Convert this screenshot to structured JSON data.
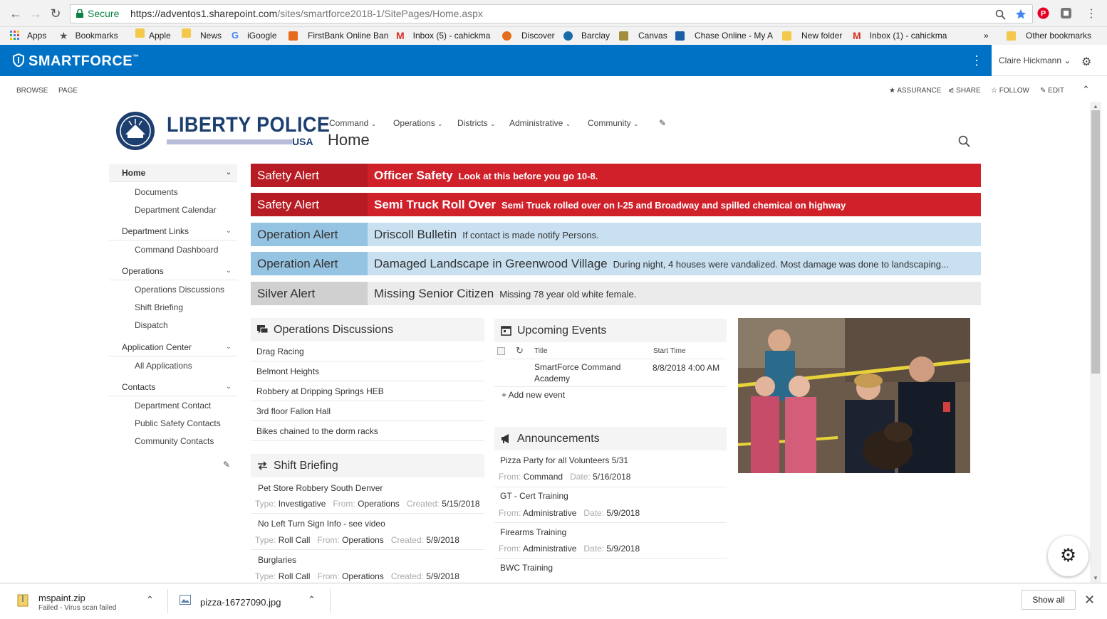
{
  "browser": {
    "secure_label": "Secure",
    "url_host": "https://adventos1.sharepoint.com",
    "url_path": "/sites/smartforce2018-1/SitePages/Home.aspx",
    "bookmarks": [
      {
        "label": "Apps",
        "icon": "apps-grid-icon",
        "color": "#4285f4"
      },
      {
        "label": "Bookmarks",
        "icon": "star-icon",
        "color": "#555555"
      },
      {
        "label": "Apple",
        "icon": "folder-icon",
        "color": "#f3c84b"
      },
      {
        "label": "News",
        "icon": "folder-icon",
        "color": "#f3c84b"
      },
      {
        "label": "iGoogle",
        "icon": "google-icon",
        "color": "#4285f4"
      },
      {
        "label": "FirstBank Online Ban",
        "icon": "bank-icon",
        "color": "#e66b1e"
      },
      {
        "label": "Inbox (5) - cahickma",
        "icon": "gmail-icon",
        "color": "#d93025"
      },
      {
        "label": "Discover",
        "icon": "discover-icon",
        "color": "#e46d1c"
      },
      {
        "label": "Barclay",
        "icon": "barclay-icon",
        "color": "#1b6aa8"
      },
      {
        "label": "Canvas",
        "icon": "canvas-icon",
        "color": "#a38d3c"
      },
      {
        "label": "Chase Online - My A",
        "icon": "chase-icon",
        "color": "#1a5ea8"
      },
      {
        "label": "New folder",
        "icon": "folder-icon",
        "color": "#f3c84b"
      },
      {
        "label": "Inbox (1) - cahickma",
        "icon": "gmail-icon",
        "color": "#d93025"
      }
    ],
    "overflow_label": "»",
    "other_bookmarks": "Other bookmarks"
  },
  "suite": {
    "brand": "SMARTFORCE",
    "brand_tm": "™",
    "user": "Claire Hickmann",
    "accent": "#0072c6"
  },
  "ribbon": {
    "browse": "BROWSE",
    "page": "PAGE",
    "assurance": "ASSURANCE",
    "share": "SHARE",
    "follow": "FOLLOW",
    "edit": "EDIT"
  },
  "site": {
    "logo_line1": "LIBERTY POLICE",
    "logo_line2": "USA",
    "page_title": "Home",
    "top_nav": [
      "Command",
      "Operations",
      "Districts",
      "Administrative",
      "Community"
    ]
  },
  "left_nav": {
    "home": "Home",
    "documents": "Documents",
    "dept_calendar": "Department Calendar",
    "dept_links": "Department Links",
    "command_dashboard": "Command Dashboard",
    "operations": "Operations",
    "ops_discussions": "Operations Discussions",
    "shift_briefing": "Shift Briefing",
    "dispatch": "Dispatch",
    "app_center": "Application Center",
    "all_apps": "All Applications",
    "contacts": "Contacts",
    "dept_contact": "Department Contact",
    "public_safety": "Public Safety Contacts",
    "community_contacts": "Community Contacts"
  },
  "alerts": [
    {
      "kind": "Safety Alert",
      "title": "Officer Safety",
      "desc": "Look at this before you go 10-8.",
      "style": "red"
    },
    {
      "kind": "Safety Alert",
      "title": "Semi Truck Roll Over",
      "desc": "Semi Truck rolled over on I-25 and Broadway and spilled chemical on highway",
      "style": "red"
    },
    {
      "kind": "Operation Alert",
      "title": "Driscoll Bulletin",
      "desc": "If contact is made notify Persons.",
      "style": "blue"
    },
    {
      "kind": "Operation Alert",
      "title": "Damaged Landscape in Greenwood Village",
      "desc": "During night, 4 houses were vandalized. Most damage was done to landscaping...",
      "style": "blue"
    },
    {
      "kind": "Silver Alert",
      "title": "Missing Senior Citizen",
      "desc": "Missing 78 year old white female.",
      "style": "grey"
    }
  ],
  "ops_discussions": {
    "title": "Operations Discussions",
    "items": [
      "Drag Racing",
      "Belmont Heights",
      "Robbery at Dripping Springs HEB",
      "3rd floor Fallon Hall",
      "Bikes chained to the dorm racks"
    ]
  },
  "shift_briefing": {
    "title": "Shift Briefing",
    "type_label": "Type:",
    "from_label": "From:",
    "created_label": "Created:",
    "items": [
      {
        "title": "Pet Store Robbery South Denver",
        "type": "Investigative",
        "from": "Operations",
        "created": "5/15/2018"
      },
      {
        "title": "No Left Turn Sign Info - see video",
        "type": "Roll Call",
        "from": "Operations",
        "created": "5/9/2018"
      },
      {
        "title": "Burglaries",
        "type": "Roll Call",
        "from": "Operations",
        "created": "5/9/2018"
      }
    ]
  },
  "events": {
    "title": "Upcoming Events",
    "col_title": "Title",
    "col_start": "Start Time",
    "items": [
      {
        "title1": "SmartForce Command",
        "title2": "Academy",
        "start": "8/8/2018 4:00 AM"
      }
    ],
    "add_new": "+ Add new event"
  },
  "announcements": {
    "title": "Announcements",
    "from_label": "From:",
    "date_label": "Date:",
    "items": [
      {
        "title": "Pizza Party for all Volunteers 5/31",
        "from": "Command",
        "date": "5/16/2018"
      },
      {
        "title": "GT - Cert Training",
        "from": "Administrative",
        "date": "5/9/2018"
      },
      {
        "title": "Firearms Training",
        "from": "Administrative",
        "date": "5/9/2018"
      },
      {
        "title": "BWC Training",
        "from": "",
        "date": ""
      }
    ]
  },
  "downloads": {
    "file1": "mspaint.zip",
    "file1_status": "Failed - Virus scan failed",
    "file2": "pizza-16727090.jpg",
    "show_all": "Show all"
  }
}
